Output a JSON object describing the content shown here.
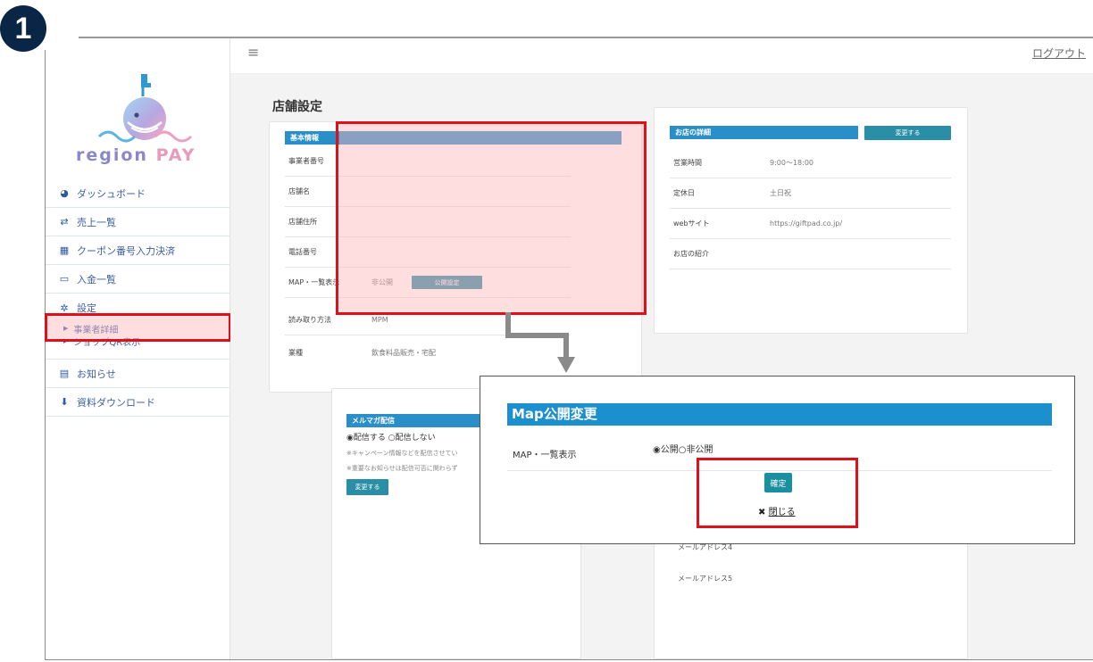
{
  "step": {
    "number": "1"
  },
  "brand": {
    "name_part1": "region",
    "name_part2": "PAY"
  },
  "sidebar": {
    "items": [
      {
        "label": "ダッシュボード",
        "icon": "dashboard-icon"
      },
      {
        "label": "売上一覧",
        "icon": "exchange-icon"
      },
      {
        "label": "クーポン番号入力決済",
        "icon": "register-icon"
      },
      {
        "label": "入金一覧",
        "icon": "card-icon"
      },
      {
        "label": "設定",
        "icon": "gear-icon"
      },
      {
        "label": "お知らせ",
        "icon": "news-icon"
      },
      {
        "label": "資料ダウンロード",
        "icon": "download-icon"
      }
    ],
    "sub_items": [
      {
        "label": "事業者詳細"
      },
      {
        "label": "ショップQR表示"
      }
    ]
  },
  "header": {
    "logout": "ログアウト",
    "menu_icon": "hamburger-icon"
  },
  "page": {
    "title": "店舗設定"
  },
  "basic_info": {
    "title": "基本情報",
    "rows": [
      {
        "key": "事業者番号",
        "value": ""
      },
      {
        "key": "店舗名",
        "value": ""
      },
      {
        "key": "店舗住所",
        "value": ""
      },
      {
        "key": "電話番号",
        "value": ""
      },
      {
        "key": "MAP・一覧表示",
        "value": "非公開",
        "button": "公開設定"
      },
      {
        "key": "読み取り方法",
        "value": "MPM"
      },
      {
        "key": "業種",
        "value": "飲食料品販売・宅配"
      }
    ]
  },
  "shop_details": {
    "title": "お店の詳細",
    "edit_button": "変更する",
    "rows": [
      {
        "key": "営業時間",
        "value": "9:00〜18:00"
      },
      {
        "key": "定休日",
        "value": "土日祝"
      },
      {
        "key": "webサイト",
        "value": "https://giftpad.co.jp/"
      },
      {
        "key": "お店の紹介",
        "value": ""
      }
    ]
  },
  "mail": {
    "title": "メルマガ配信",
    "option_on": "◉配信する",
    "option_off": "○配信しない",
    "note1": "※キャンペーン情報などを配信させてい",
    "note2": "※重要なお知らせは配信可否に関わらず",
    "button": "変更する"
  },
  "emails": {
    "email4": "メールアドレス4",
    "email5": "メールアドレス5"
  },
  "modal": {
    "title": "Map公開変更",
    "field_label": "MAP・一覧表示",
    "option_public": "◉公開",
    "option_private": "○非公開",
    "confirm": "確定",
    "close_mark": "✖",
    "close": "閉じる"
  },
  "colors": {
    "accent": "#2a8ec9",
    "highlight": "#e0101a",
    "badge": "#0a2647"
  }
}
